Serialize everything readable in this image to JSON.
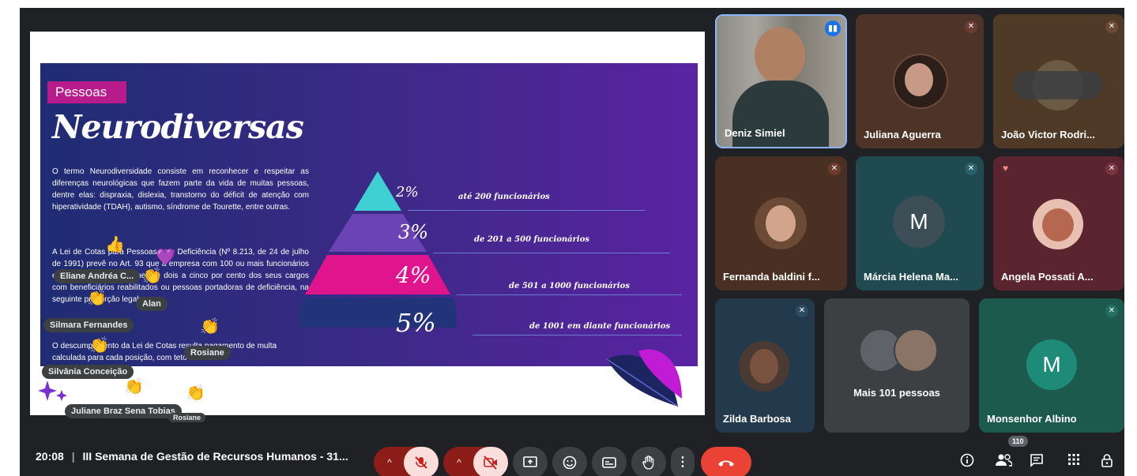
{
  "slide": {
    "badge": "Pessoas",
    "title": "Neurodiversas",
    "para1": "O termo Neurodiversidade consiste em reconhecer e respeitar as diferenças neurológicas que fazem parte da vida de muitas pessoas, dentre elas: dispraxia, dislexia, transtorno do déficit de atenção com hiperatividade (TDAH), autismo, síndrome de Tourette, entre outras.",
    "para2": "A Lei de Cotas para Pessoas com Deficiência (Nº 8.213, de 24 de julho de 1991) prevê no Art. 93 que a empresa com 100 ou mais funcionários está obrigada a preencher de dois a cinco por cento dos seus cargos com beneficiários reabilitados ou pessoas portadoras de deficiência, na seguinte proporção legal:",
    "para3": "O descumprimento da Lei de Cotas resulta pagamento de multa calculada para cada posição, com teto máximo.",
    "tiers": [
      {
        "pct": "2%",
        "label": "até 200 funcionários"
      },
      {
        "pct": "3%",
        "label": "de 201 a 500 funcionários"
      },
      {
        "pct": "4%",
        "label": "de 501 a 1000 funcionários"
      },
      {
        "pct": "5%",
        "label": "de 1001 em diante funcionários"
      }
    ]
  },
  "reactions": {
    "names": [
      "Eliane Andréa C...",
      "Alan",
      "Silmara Fernandes",
      "Rosiane",
      "Silvânia Conceição",
      "Juliane Braz Sena Tobias",
      "Rosiane"
    ],
    "emojis": [
      "👍",
      "💜",
      "👏",
      "👏",
      "👏",
      "👏",
      "👏",
      "👏"
    ]
  },
  "participants": [
    {
      "name": "Deniz Simiel",
      "muted": false,
      "speaking": true
    },
    {
      "name": "Juliana Aguerra",
      "muted": true
    },
    {
      "name": "João Victor Rodri...",
      "muted": true
    },
    {
      "name": "Fernanda baldini f...",
      "muted": true
    },
    {
      "name": "Márcia Helena Ma...",
      "muted": true,
      "initial": "M"
    },
    {
      "name": "Angela Possati A...",
      "muted": true
    },
    {
      "name": "Zilda Barbosa",
      "muted": true
    },
    {
      "name": "Mais 101 pessoas"
    },
    {
      "name": "Monsenhor Albino",
      "muted": true,
      "initial": "M"
    }
  ],
  "bottom_bar": {
    "time": "20:08",
    "separator": "|",
    "meeting_title": "III Semana de Gestão de Recursos Humanos - 31...",
    "participant_count": "110"
  },
  "icons": {
    "chevron_up": "^",
    "mic_off": "mic-off",
    "cam_off": "camera-off",
    "present": "present-screen",
    "emoji": "emoji",
    "captions": "captions",
    "raise_hand": "raise-hand",
    "more": "more-vert",
    "end_call": "end-call",
    "info": "info",
    "people": "people",
    "chat": "chat",
    "activities": "apps-grid",
    "lock": "host-controls"
  },
  "colors": {
    "end_call": "#ea4335",
    "badge": "#b81c8c",
    "tier1": "#3fd0d4",
    "tier2": "#6a44b4",
    "tier3": "#e0148c",
    "tier4": "#23337a"
  }
}
